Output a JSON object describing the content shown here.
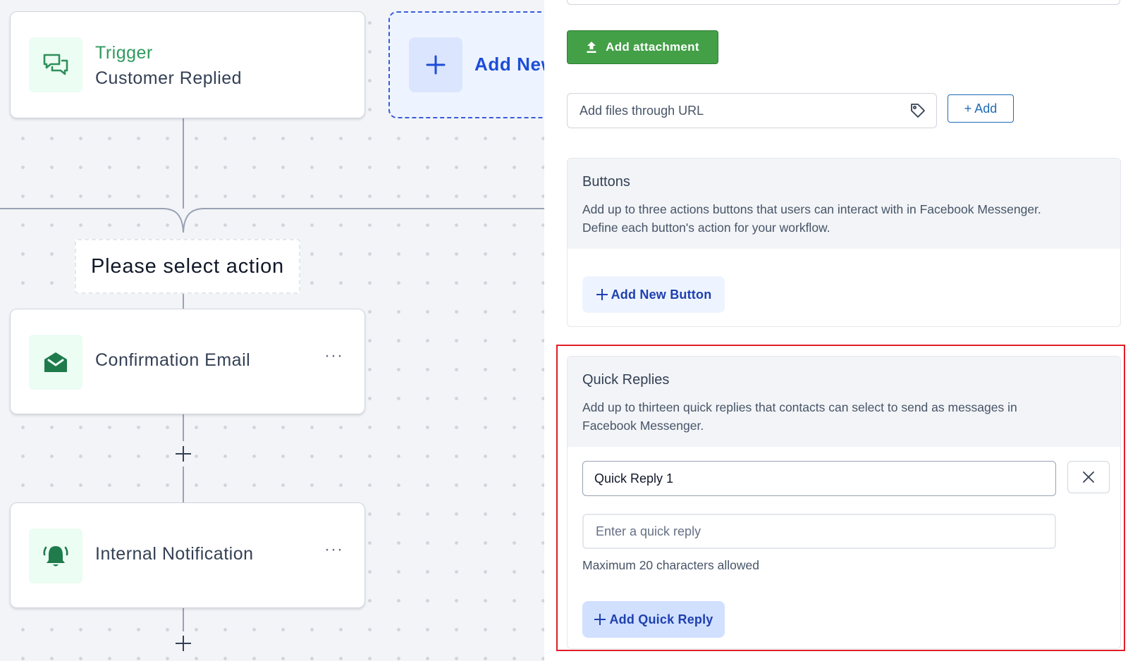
{
  "canvas": {
    "trigger": {
      "kicker": "Trigger",
      "title": "Customer Replied",
      "icon": "chat-bubbles-icon"
    },
    "add_new": {
      "label": "Add New"
    },
    "select_action": "Please select action",
    "nodes": [
      {
        "title": "Confirmation Email",
        "icon": "envelope-open-icon",
        "menu": "···"
      },
      {
        "title": "Internal Notification",
        "icon": "bell-ringing-icon",
        "menu": "···"
      }
    ]
  },
  "panel": {
    "attachment_button": "Add attachment",
    "url_field": {
      "placeholder": "Add files through URL"
    },
    "add_url_button": "+ Add",
    "buttons_section": {
      "title": "Buttons",
      "description_line1": "Add up to three actions buttons that users can interact with in Facebook Messenger.",
      "description_line2": "Define each button's action for your workflow.",
      "add_button_label": "Add New Button"
    },
    "quick_replies_section": {
      "title": "Quick Replies",
      "description_line1": "Add up to thirteen quick replies that contacts can select to send as messages in",
      "description_line2": "Facebook Messenger.",
      "reply_value": "Quick Reply 1",
      "new_reply_placeholder": "Enter a quick reply",
      "helper": "Maximum 20 characters allowed",
      "add_button_label": "Add Quick Reply"
    }
  },
  "colors": {
    "accent_green": "#43a047",
    "accent_blue": "#1e40af",
    "highlight_red": "#e11d26"
  }
}
